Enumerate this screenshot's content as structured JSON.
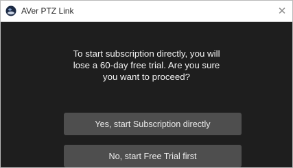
{
  "window": {
    "title": "AVer PTZ Link",
    "close_symbol": "✕",
    "icon": "aver-app-icon"
  },
  "dialog": {
    "message_lines": [
      "To start subscription directly, you will",
      "lose a 60-day free trial. Are you sure",
      "you want to proceed?"
    ],
    "buttons": {
      "yes_label": "Yes, start Subscription directly",
      "no_label": "No, start Free Trial first"
    }
  },
  "colors": {
    "background": "#1e1e1e",
    "button": "#4e4e4e",
    "text": "#f2f2f2",
    "titlebar": "#ffffff"
  }
}
